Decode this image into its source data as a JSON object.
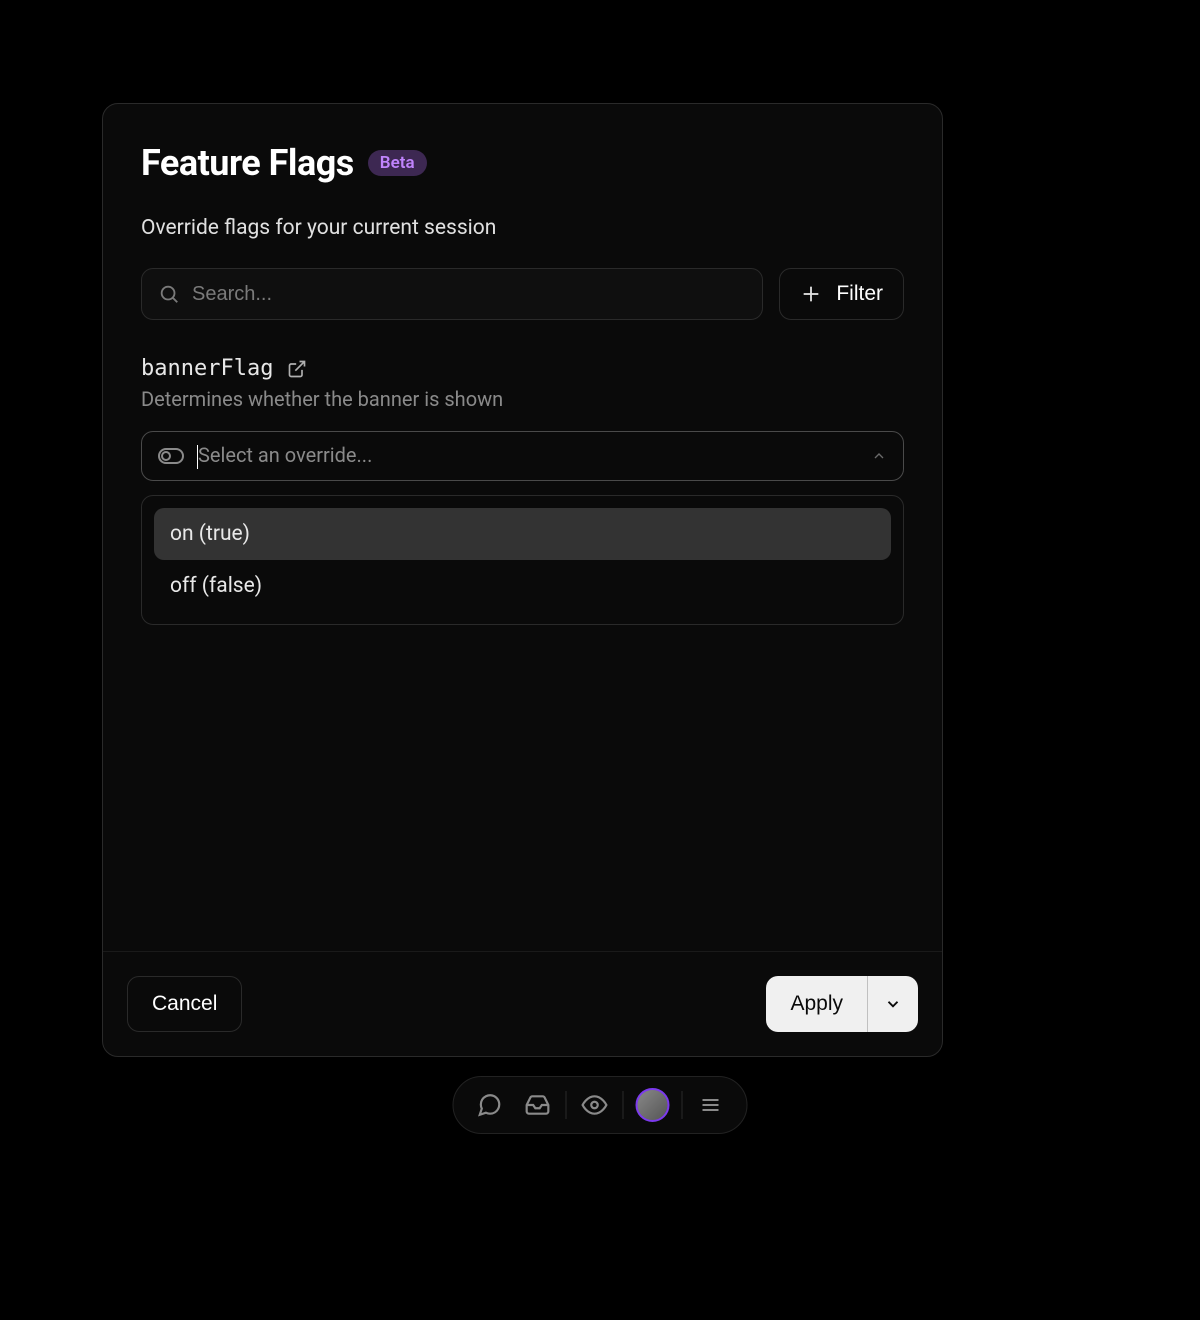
{
  "header": {
    "title": "Feature Flags",
    "badge": "Beta",
    "subtitle": "Override flags for your current session"
  },
  "search": {
    "placeholder": "Search..."
  },
  "filter": {
    "label": "Filter"
  },
  "flag": {
    "name": "bannerFlag",
    "description": "Determines whether the banner is shown"
  },
  "combobox": {
    "placeholder": "Select an override..."
  },
  "options": [
    {
      "label": "on (true)",
      "highlighted": true
    },
    {
      "label": "off (false)",
      "highlighted": false
    }
  ],
  "footer": {
    "cancel": "Cancel",
    "apply": "Apply"
  }
}
